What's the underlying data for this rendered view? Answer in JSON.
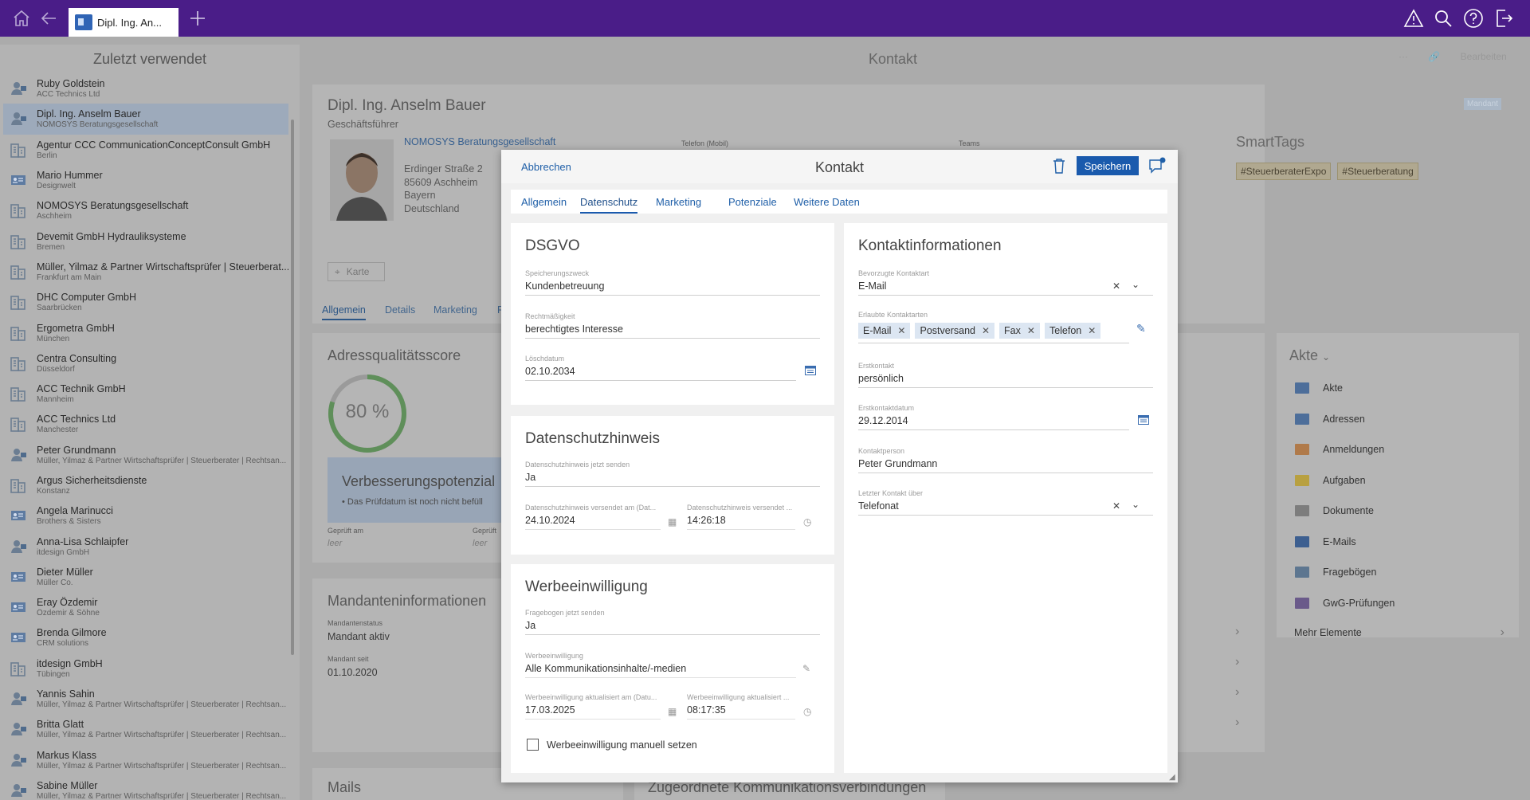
{
  "topbar": {
    "tab_label": "Dipl. Ing. An...",
    "icons": [
      "home-icon",
      "back-icon",
      "add-tab-icon",
      "warning-icon",
      "search-icon",
      "help-icon",
      "logout-icon"
    ]
  },
  "left": {
    "title": "Zuletzt verwendet",
    "items": [
      {
        "name": "Ruby Goldstein",
        "sub": "ACC Technics Ltd",
        "type": "person"
      },
      {
        "name": "Dipl. Ing. Anselm Bauer",
        "sub": "NOMOSYS Beratungsgesellschaft",
        "type": "person"
      },
      {
        "name": "Agentur CCC CommunicationConceptConsult GmbH",
        "sub": "Berlin",
        "type": "company"
      },
      {
        "name": "Mario Hummer",
        "sub": "Designwelt",
        "type": "card"
      },
      {
        "name": "NOMOSYS Beratungsgesellschaft",
        "sub": "Aschheim",
        "type": "company"
      },
      {
        "name": "Devemit GmbH Hydrauliksysteme",
        "sub": "Bremen",
        "type": "company"
      },
      {
        "name": "Müller, Yilmaz & Partner Wirtschaftsprüfer | Steuerberat...",
        "sub": "Frankfurt am Main",
        "type": "company"
      },
      {
        "name": "DHC Computer GmbH",
        "sub": "Saarbrücken",
        "type": "company"
      },
      {
        "name": "Ergometra GmbH",
        "sub": "München",
        "type": "company"
      },
      {
        "name": "Centra Consulting",
        "sub": "Düsseldorf",
        "type": "company"
      },
      {
        "name": "ACC Technik GmbH",
        "sub": "Mannheim",
        "type": "company"
      },
      {
        "name": "ACC Technics Ltd",
        "sub": "Manchester",
        "type": "company"
      },
      {
        "name": "Peter Grundmann",
        "sub": "Müller, Yilmaz & Partner Wirtschaftsprüfer | Steuerberater | Rechtsan...",
        "type": "person"
      },
      {
        "name": "Argus Sicherheitsdienste",
        "sub": "Konstanz",
        "type": "company"
      },
      {
        "name": "Angela Marinucci",
        "sub": "Brothers & Sisters",
        "type": "card"
      },
      {
        "name": "Anna-Lisa Schlaipfer",
        "sub": "itdesign GmbH",
        "type": "person"
      },
      {
        "name": "Dieter Müller",
        "sub": "Müller Co.",
        "type": "card"
      },
      {
        "name": "Eray Özdemir",
        "sub": "Özdemir & Söhne",
        "type": "card"
      },
      {
        "name": "Brenda Gilmore",
        "sub": "CRM solutions",
        "type": "card"
      },
      {
        "name": "itdesign GmbH",
        "sub": "Tübingen",
        "type": "company"
      },
      {
        "name": "Yannis Sahin",
        "sub": "Müller, Yilmaz & Partner Wirtschaftsprüfer | Steuerberater | Rechtsan...",
        "type": "person"
      },
      {
        "name": "Britta Glatt",
        "sub": "Müller, Yilmaz & Partner Wirtschaftsprüfer | Steuerberater | Rechtsan...",
        "type": "person"
      },
      {
        "name": "Markus Klass",
        "sub": "Müller, Yilmaz & Partner Wirtschaftsprüfer | Steuerberater | Rechtsan...",
        "type": "person"
      },
      {
        "name": "Sabine Müller",
        "sub": "Müller, Yilmaz & Partner Wirtschaftsprüfer | Steuerberater | Rechtsan...",
        "type": "person"
      }
    ]
  },
  "main": {
    "title": "Kontakt",
    "edit_label": "Bearbeiten",
    "person_name": "Dipl. Ing. Anselm Bauer",
    "person_role": "Geschäftsführer",
    "company": "NOMOSYS Beratungsgesellschaft",
    "address": [
      "Erdinger Straße 2",
      "85609 Aschheim",
      "Bayern",
      "Deutschland"
    ],
    "phone_label": "Telefon (Mobil)",
    "teams_label": "Teams",
    "mandant_badge": "Mandant",
    "smarttags_title": "SmartTags",
    "smarttags": [
      "#SteuerberaterExpo",
      "#Steuerberatung"
    ],
    "map_button": "Karte",
    "tabs": [
      "Allgemein",
      "Details",
      "Marketing",
      "P"
    ],
    "score_title": "Adressqualitätsscore",
    "score_value": "80 %",
    "score_percent": 80,
    "improve_title": "Verbesserungspotenzial",
    "improve_text": "• Das Prüfdatum ist noch nicht befüll",
    "checked_label": "Geprüft am",
    "checked_label2": "Geprüft",
    "checked_value": "leer",
    "checked_value2": "leer",
    "mandant_title": "Mandanteninformationen",
    "mandant_status_label": "Mandantenstatus",
    "mandant_status": "Mandant aktiv",
    "mandant_since_label": "Mandant seit",
    "mandant_since": "01.10.2020",
    "mails_title": "Mails",
    "komm_title": "Zugeordnete Kommunikationsverbindungen",
    "akte_title": "Akte",
    "akte_items": [
      "Akte",
      "Adressen",
      "Anmeldungen",
      "Aufgaben",
      "Dokumente",
      "E-Mails",
      "Fragebögen",
      "GwG-Prüfungen"
    ],
    "more_label": "Mehr Elemente"
  },
  "modal": {
    "cancel": "Abbrechen",
    "title": "Kontakt",
    "save": "Speichern",
    "tabs": [
      "Allgemein",
      "Datenschutz",
      "Marketing",
      "Potenziale",
      "Weitere Daten"
    ],
    "active_tab": "Datenschutz",
    "dsgvo": {
      "title": "DSGVO",
      "purpose_label": "Speicherungszweck",
      "purpose": "Kundenbetreuung",
      "legality_label": "Rechtmäßigkeit",
      "legality": "berechtigtes Interesse",
      "delete_label": "Löschdatum",
      "delete_date": "02.10.2034"
    },
    "privacy": {
      "title": "Datenschutzhinweis",
      "send_label": "Datenschutzhinweis jetzt senden",
      "send": "Ja",
      "sent_date_label": "Datenschutzhinweis versendet am (Dat...",
      "sent_date": "24.10.2024",
      "sent_time_label": "Datenschutzhinweis versendet ...",
      "sent_time": "14:26:18"
    },
    "consent": {
      "title": "Werbeeinwilligung",
      "send_label": "Fragebogen jetzt senden",
      "send": "Ja",
      "consent_label": "Werbeeinwilligung",
      "consent": "Alle Kommunikationsinhalte/-medien",
      "updated_date_label": "Werbeeinwilligung aktualisiert am (Datu...",
      "updated_date": "17.03.2025",
      "updated_time_label": "Werbeeinwilligung aktualisiert ...",
      "updated_time": "08:17:35",
      "manual_label": "Werbeeinwilligung manuell setzen"
    },
    "contact_info": {
      "title": "Kontaktinformationen",
      "preferred_label": "Bevorzugte Kontaktart",
      "preferred": "E-Mail",
      "allowed_label": "Erlaubte Kontaktarten",
      "allowed": [
        "E-Mail",
        "Postversand",
        "Fax",
        "Telefon"
      ],
      "first_label": "Erstkontakt",
      "first": "persönlich",
      "first_date_label": "Erstkontaktdatum",
      "first_date": "29.12.2014",
      "person_label": "Kontaktperson",
      "person": "Peter Grundmann",
      "last_label": "Letzter Kontakt über",
      "last": "Telefonat"
    }
  }
}
